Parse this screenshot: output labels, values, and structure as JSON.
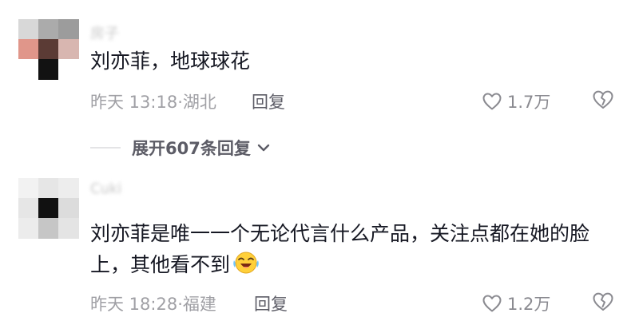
{
  "comments": [
    {
      "username": "房子",
      "text": "刘亦菲，地球球花",
      "time": "昨天 13:18",
      "location": "湖北",
      "reply_label": "回复",
      "like_count": "1.7万"
    },
    {
      "username": "Cuki",
      "text": "刘亦菲是唯一一个无论代言什么产品，关注点都在她的脸上，其他看不到",
      "time": "昨天 18:28",
      "location": "福建",
      "reply_label": "回复",
      "like_count": "1.2万"
    }
  ],
  "expand_replies": "展开607条回复",
  "colors": {
    "text": "#161823",
    "meta": "#a0a0a5",
    "reply": "#5c5c66",
    "icon": "#8a8a90"
  },
  "icons": [
    "heart-outline-icon",
    "broken-heart-icon",
    "chevron-down-icon",
    "laughing-crying-emoji-icon"
  ]
}
